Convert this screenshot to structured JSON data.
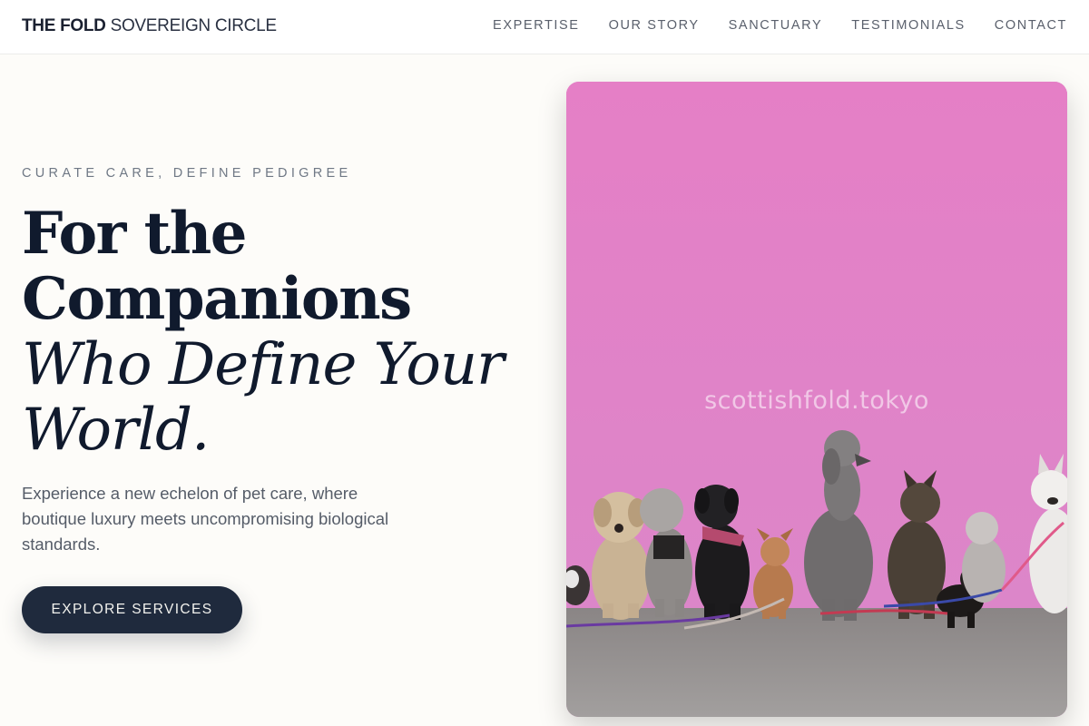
{
  "header": {
    "brand_strong": "THE FOLD",
    "brand_light": "SOVEREIGN CIRCLE",
    "nav": [
      {
        "label": "EXPERTISE"
      },
      {
        "label": "OUR STORY"
      },
      {
        "label": "SANCTUARY"
      },
      {
        "label": "TESTIMONIALS"
      },
      {
        "label": "CONTACT"
      }
    ]
  },
  "hero": {
    "eyebrow": "CURATE CARE, DEFINE PEDIGREE",
    "headline_line1": "For the",
    "headline_line2": "Companions",
    "headline_line3": "Who Define Your",
    "headline_line4": "World.",
    "description": "Experience a new echelon of pet care, where boutique luxury meets uncompromising biological standards.",
    "cta_label": "EXPLORE SERVICES",
    "image": {
      "subject": "dogs-in-front-of-pink-wall",
      "watermark": "scottishfold.tokyo"
    }
  },
  "colors": {
    "page_background": "#fdfcf9",
    "primary_dark": "#1f2a3d",
    "headline": "#101a2d",
    "wall_pink": "#e183c8",
    "ground_gray": "#8e8a8a"
  }
}
